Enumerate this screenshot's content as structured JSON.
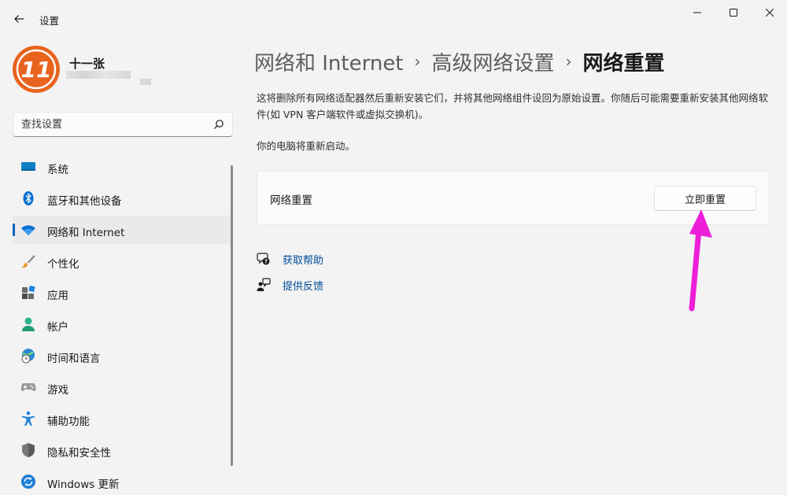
{
  "window": {
    "title": "设置"
  },
  "profile": {
    "avatar_text": "11",
    "user_name": "十一张"
  },
  "search": {
    "placeholder": "查找设置"
  },
  "sidebar": {
    "items": [
      {
        "label": "系统",
        "icon": "system-display-icon"
      },
      {
        "label": "蓝牙和其他设备",
        "icon": "bluetooth-icon"
      },
      {
        "label": "网络和 Internet",
        "icon": "wifi-icon",
        "selected": true
      },
      {
        "label": "个性化",
        "icon": "brush-icon"
      },
      {
        "label": "应用",
        "icon": "apps-icon"
      },
      {
        "label": "帐户",
        "icon": "account-icon"
      },
      {
        "label": "时间和语言",
        "icon": "globe-clock-icon"
      },
      {
        "label": "游戏",
        "icon": "gamepad-icon"
      },
      {
        "label": "辅助功能",
        "icon": "accessibility-icon"
      },
      {
        "label": "隐私和安全性",
        "icon": "shield-icon"
      },
      {
        "label": "Windows 更新",
        "icon": "update-icon"
      }
    ]
  },
  "breadcrumb": {
    "level1": "网络和 Internet",
    "separator": "›",
    "level2": "高级网络设置",
    "current": "网络重置"
  },
  "main": {
    "description": "这将删除所有网络适配器然后重新安装它们，并将其他网络组件设回为原始设置。你随后可能需要重新安装其他网络软件(如 VPN 客户端软件或虚拟交换机)。",
    "restart_note": "你的电脑将重新启动。",
    "card_label": "网络重置",
    "reset_button": "立即重置",
    "help_link": "获取帮助",
    "feedback_link": "提供反馈"
  },
  "colors": {
    "accent": "#005fb8",
    "link": "#004c99",
    "annotation_arrow": "#ee1fd9",
    "avatar": "#e8641e"
  }
}
